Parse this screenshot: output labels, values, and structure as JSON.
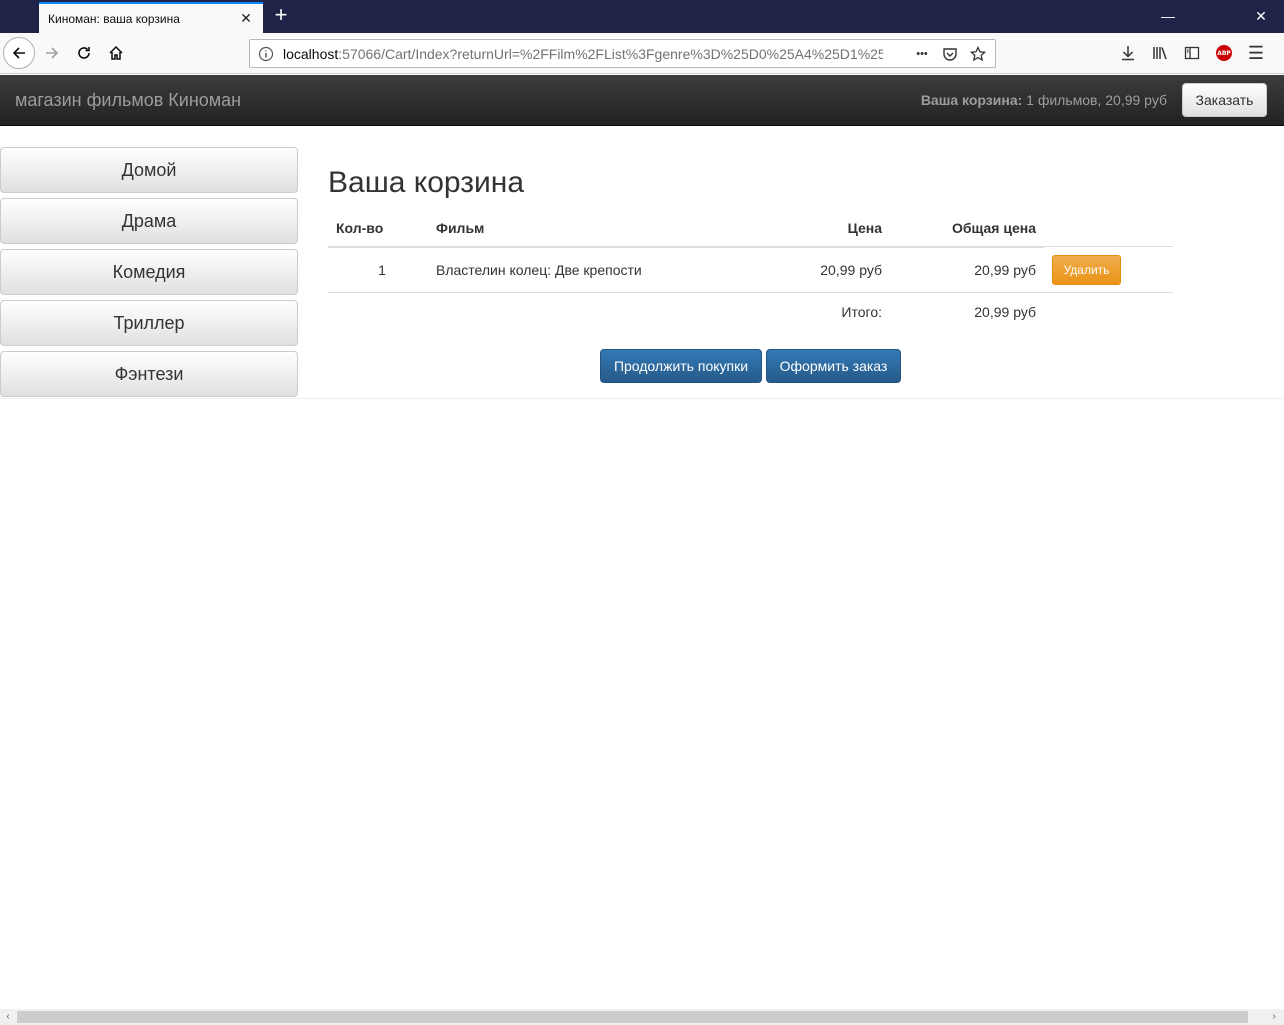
{
  "browser": {
    "tab_title": "Киноман: ваша корзина",
    "tab_close_glyph": "✕",
    "new_tab_glyph": "+",
    "minimize_glyph": "—",
    "close_glyph": "✕",
    "url_host": "localhost",
    "url_rest": ":57066/Cart/Index?returnUrl=%2FFilm%2FList%3Fgenre%3D%25D0%25A4%25D1%258",
    "abp_label": "ABP",
    "menu_glyph": "☰",
    "more_glyph": "•••"
  },
  "site": {
    "brand": "магазин фильмов Киноман",
    "cart_label": "Ваша корзина:",
    "cart_value": " 1 фильмов, 20,99 руб",
    "checkout_button": "Заказать"
  },
  "sidebar": {
    "categories": [
      {
        "label": "Домой"
      },
      {
        "label": "Драма"
      },
      {
        "label": "Комедия"
      },
      {
        "label": "Триллер"
      },
      {
        "label": "Фэнтези"
      }
    ]
  },
  "cart": {
    "title": "Ваша корзина",
    "headers": {
      "qty": "Кол-во",
      "film": "Фильм",
      "price": "Цена",
      "subtotal": "Общая цена"
    },
    "items": [
      {
        "qty": "1",
        "film": "Властелин колец: Две крепости",
        "price": "20,99 руб",
        "subtotal": "20,99 руб",
        "remove_label": "Удалить"
      }
    ],
    "total_label": "Итого:",
    "total_value": "20,99 руб",
    "continue_button": "Продолжить покупки",
    "order_button": "Оформить заказ"
  },
  "colors": {
    "titlebar": "#1f2347",
    "navbar_dark": "#222222",
    "primary": "#337ab7",
    "warning": "#f0ad4e"
  },
  "scrollbar": {
    "left_arrow": "‹",
    "right_arrow": "›"
  }
}
